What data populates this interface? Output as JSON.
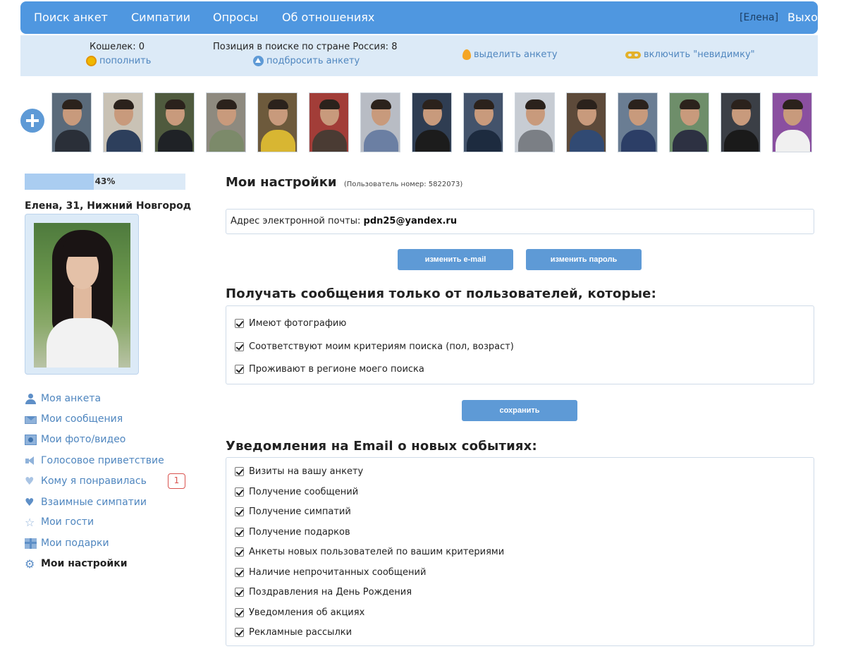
{
  "nav": {
    "items": [
      "Поиск анкет",
      "Симпатии",
      "Опросы",
      "Об отношениях"
    ],
    "user": "[Елена]",
    "logout": "Выход"
  },
  "infobar": {
    "wallet": "Кошелек: 0",
    "topup": "пополнить",
    "position": "Позиция в поиске по стране Россия: 8",
    "boost": "подбросить анкету",
    "highlight": "выделить анкету",
    "invisible": "включить \"невидимку\""
  },
  "photo_strip": {
    "count": 15
  },
  "profile": {
    "completion_percent": 43,
    "completion_label": "43%",
    "name": "Елена, 31, Нижний Новгород"
  },
  "menu": {
    "items": [
      {
        "label": "Моя анкета",
        "icon": "user-icon"
      },
      {
        "label": "Мои сообщения",
        "icon": "mail-icon"
      },
      {
        "label": "Мои фото/видео",
        "icon": "photo-icon"
      },
      {
        "label": "Голосовое приветствие",
        "icon": "speaker-icon"
      },
      {
        "label": "Кому я понравилась",
        "icon": "heart-outline-icon"
      },
      {
        "label": "Взаимные симпатии",
        "icon": "heart-icon"
      },
      {
        "label": "Мои гости",
        "icon": "star-icon"
      },
      {
        "label": "Мои подарки",
        "icon": "gift-icon"
      },
      {
        "label": "Мои настройки",
        "icon": "gear-icon"
      }
    ],
    "likes_badge": "1"
  },
  "settings": {
    "title": "Мои настройки",
    "user_number": "(Пользователь номер: 5822073)",
    "email_label": "Адрес электронной почты:",
    "email_value": "pdn25@yandex.ru",
    "change_email": "изменить e-mail",
    "change_password": "изменить пароль",
    "messages_title": "Получать сообщения только от пользователей, которые:",
    "messages_options": [
      {
        "label": "Имеют фотографию",
        "checked": true
      },
      {
        "label": "Соответствуют моим критериям поиска (пол, возраст)",
        "checked": true
      },
      {
        "label": "Проживают в регионе моего поиска",
        "checked": true
      }
    ],
    "save": "сохранить",
    "email_title": "Уведомления на Email о новых событиях:",
    "email_options": [
      {
        "label": "Визиты на вашу анкету",
        "checked": true
      },
      {
        "label": "Получение сообщений",
        "checked": true
      },
      {
        "label": "Получение симпатий",
        "checked": true
      },
      {
        "label": "Получение подарков",
        "checked": true
      },
      {
        "label": "Анкеты новых пользователей по вашим критериями",
        "checked": true
      },
      {
        "label": "Наличие непрочитанных сообщений",
        "checked": true
      },
      {
        "label": "Поздравления на День Рождения",
        "checked": true
      },
      {
        "label": "Уведомления об акциях",
        "checked": true
      },
      {
        "label": "Рекламные рассылки",
        "checked": true
      }
    ]
  },
  "colors": {
    "accent": "#4f97e0",
    "infobar": "#dceaf7",
    "link": "#4f86bf",
    "badge": "#d9534f"
  }
}
